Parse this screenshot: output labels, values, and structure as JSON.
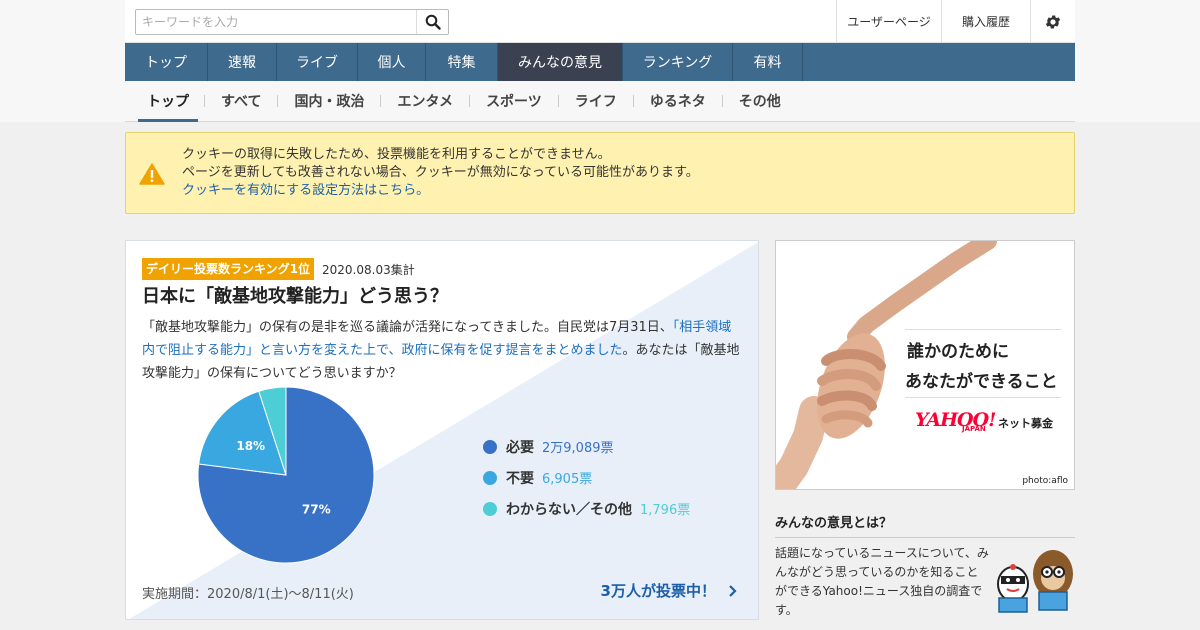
{
  "search": {
    "placeholder": "キーワードを入力"
  },
  "util_links": {
    "user_page": "ユーザーページ",
    "purchase_history": "購入履歴"
  },
  "main_nav": [
    {
      "label": "トップ",
      "active": false
    },
    {
      "label": "速報",
      "active": false
    },
    {
      "label": "ライブ",
      "active": false
    },
    {
      "label": "個人",
      "active": false
    },
    {
      "label": "特集",
      "active": false
    },
    {
      "label": "みんなの意見",
      "active": true
    },
    {
      "label": "ランキング",
      "active": false
    },
    {
      "label": "有料",
      "active": false
    }
  ],
  "sub_nav": [
    {
      "label": "トップ",
      "active": true
    },
    {
      "label": "すべて",
      "active": false
    },
    {
      "label": "国内・政治",
      "active": false
    },
    {
      "label": "エンタメ",
      "active": false
    },
    {
      "label": "スポーツ",
      "active": false
    },
    {
      "label": "ライフ",
      "active": false
    },
    {
      "label": "ゆるネタ",
      "active": false
    },
    {
      "label": "その他",
      "active": false
    }
  ],
  "alert": {
    "line1": "クッキーの取得に失敗したため、投票機能を利用することができません。",
    "line2": "ページを更新しても改善されない場合、クッキーが無効になっている可能性があります。",
    "link": "クッキーを有効にする設定方法はこちら。"
  },
  "poll": {
    "badge": "デイリー投票数ランキング1位",
    "date": "2020.08.03集計",
    "title": "日本に「敵基地攻撃能力」どう思う？",
    "desc_before": "「敵基地攻撃能力」の保有の是非を巡る議論が活発になってきました。自民党は7月31日、",
    "desc_link": "「相手領域内で阻止する能力」と言い方を変えた上で、政府に保有を促す提言をまとめました",
    "desc_after": "。あなたは「敵基地攻撃能力」の保有についてどう思いますか？",
    "options": [
      {
        "label": "必要",
        "votes": "2万9,089票",
        "percent": 77,
        "pct_label": "77%",
        "color": "#3872c6"
      },
      {
        "label": "不要",
        "votes": "6,905票",
        "percent": 18,
        "pct_label": "18%",
        "color": "#3aa8e0"
      },
      {
        "label": "わからない／その他",
        "votes": "1,796票",
        "percent": 5,
        "pct_label": "",
        "color": "#4dcdd6"
      }
    ],
    "period": "実施期間：2020/8/1(土)〜8/11(火)",
    "cta": "3万人が投票中！"
  },
  "ad": {
    "line1": "誰かのために",
    "line2": "あなたができること",
    "logo": "YAHOO!",
    "logo_sub": "JAPAN",
    "service": "ネット募金",
    "photo_credit": "photo:aflo"
  },
  "about": {
    "title": "みんなの意見とは？",
    "text": "話題になっているニュースについて、みんながどう思っているのかを知ることができるYahoo!ニュース独自の調査です。"
  },
  "icons": {
    "search": "search-icon",
    "gear": "gear-icon",
    "warning": "warning-icon",
    "chevron": "chevron-right-icon"
  },
  "colors": {
    "nav_bg": "#3e6a8d",
    "nav_active": "#3a4150",
    "alert_bg": "#fff2b0",
    "badge": "#f0a200",
    "link": "#1c5fa8",
    "warning": "#f0a200"
  }
}
